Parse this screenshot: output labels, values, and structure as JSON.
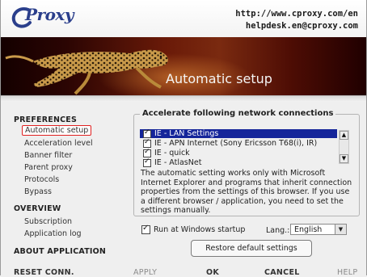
{
  "header": {
    "logo_text": "Proxy",
    "website": "http://www.cproxy.com/en",
    "email": "helpdesk.en@cproxy.com"
  },
  "banner": {
    "title": "Automatic setup"
  },
  "sidebar": {
    "preferences_label": "PREFERENCES",
    "preferences_items": [
      {
        "label": "Automatic setup",
        "selected": true
      },
      {
        "label": "Acceleration level"
      },
      {
        "label": "Banner filter"
      },
      {
        "label": "Parent proxy"
      },
      {
        "label": "Protocols"
      },
      {
        "label": "Bypass"
      }
    ],
    "overview_label": "OVERVIEW",
    "overview_items": [
      {
        "label": "Subscription"
      },
      {
        "label": "Application log"
      }
    ],
    "about_label": "ABOUT APPLICATION"
  },
  "group": {
    "title": "Accelerate following network connections",
    "connections": [
      {
        "label": "IE - LAN Settings",
        "checked": true,
        "selected": true
      },
      {
        "label": "IE - APN Internet (Sony Ericsson T68(i), IR)",
        "checked": true
      },
      {
        "label": "IE - quick",
        "checked": true
      },
      {
        "label": "IE - AtlasNet",
        "checked": true
      }
    ],
    "description": "The automatic setting works only with Microsoft Internet Explorer and programs that inherit connection properties from the settings of this browser. If you use a different browser / application, you need to set the settings manually."
  },
  "startup": {
    "label": "Run at Windows startup",
    "checked": true
  },
  "language": {
    "label": "Lang.:",
    "value": "English"
  },
  "restore_label": "Restore default settings",
  "footer": {
    "reset": "RESET CONN.",
    "apply": "APPLY",
    "ok": "OK",
    "cancel": "CANCEL",
    "help": "HELP"
  },
  "colors": {
    "selection": "#15259a",
    "highlight_border": "#e02020",
    "logo": "#2b3f8c"
  }
}
